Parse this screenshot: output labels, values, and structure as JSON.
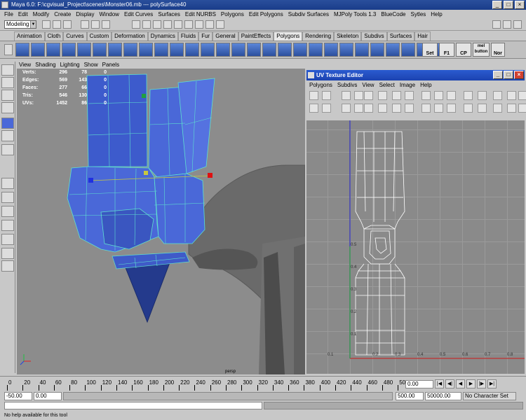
{
  "window": {
    "title": "Maya 6.0: F:\\cgvisual_Project\\scenes\\Monster06.mb   ---   polySurface40"
  },
  "menubar": [
    "File",
    "Edit",
    "Modify",
    "Create",
    "Display",
    "Window",
    "Edit Curves",
    "Surfaces",
    "Edit NURBS",
    "Polygons",
    "Edit Polygons",
    "Subdiv Surfaces",
    "MJPoly Tools 1.3",
    "BlueCode",
    "Sytles",
    "Help"
  ],
  "status": {
    "mode": "Modeling"
  },
  "shelf_tabs": [
    "Animation",
    "Cloth",
    "Curves",
    "Custom",
    "Deformation",
    "Dynamics",
    "Fluids",
    "Fur",
    "General",
    "PaintEffects",
    "Polygons",
    "Rendering",
    "Skeleton",
    "Subdivs",
    "Surfaces",
    "Hair"
  ],
  "shelf_tab_active": "Polygons",
  "shelf_labels": [
    "Set",
    "F1",
    "CP",
    "mel button",
    "Nor"
  ],
  "viewport": {
    "menu": [
      "View",
      "Shading",
      "Lighting",
      "Show",
      "Panels"
    ],
    "camera": "persp",
    "hud": [
      {
        "label": "Verts:",
        "a": "296",
        "b": "78",
        "c": "0"
      },
      {
        "label": "Edges:",
        "a": "569",
        "b": "143",
        "c": "0"
      },
      {
        "label": "Faces:",
        "a": "277",
        "b": "66",
        "c": "0"
      },
      {
        "label": "Tris:",
        "a": "546",
        "b": "130",
        "c": "0"
      },
      {
        "label": "UVs:",
        "a": "1452",
        "b": "86",
        "c": "0"
      }
    ]
  },
  "uv_editor": {
    "title": "UV Texture Editor",
    "menu": [
      "Polygons",
      "Subdivs",
      "View",
      "Select",
      "Image",
      "Help"
    ],
    "y_ticks": [
      "0.5",
      "0.4",
      "0.3",
      "0.2",
      "0.1"
    ],
    "x_ticks": [
      "0.1",
      "0.2",
      "0.3",
      "0.4",
      "0.5",
      "0.6",
      "0.7",
      "0.8"
    ]
  },
  "timeline": {
    "ticks": [
      "0",
      "20",
      "40",
      "60",
      "80",
      "100",
      "120",
      "140",
      "160",
      "180",
      "200",
      "220",
      "240",
      "260",
      "280",
      "300",
      "320",
      "340",
      "360",
      "380",
      "400",
      "420",
      "440",
      "460",
      "480",
      "500"
    ],
    "current_time": "0.00"
  },
  "range": {
    "start_outer": "-50.00",
    "start_inner": "0.00",
    "end_inner": "500.00",
    "end_outer": "50000.00",
    "character_set": "No Character Set"
  },
  "help": {
    "text": "No help available for this tool"
  },
  "colors": {
    "mesh_blue": "#4a68d8",
    "wire_cyan": "#5ee0d0",
    "viewport_bg": "#8c8c8c",
    "uv_title": "#2a5bd0"
  }
}
